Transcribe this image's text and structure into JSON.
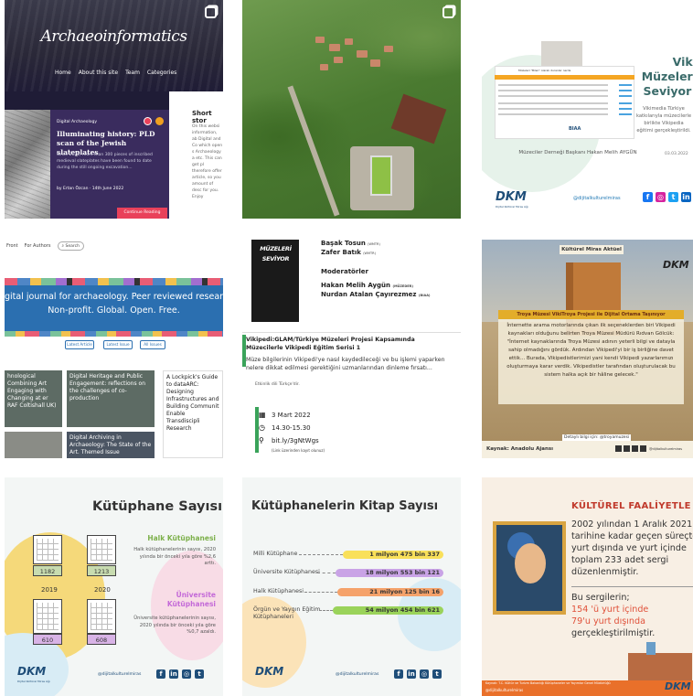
{
  "tile1": {
    "logo": "Archaeoinformatics",
    "nav": [
      "Home",
      "About this site",
      "Team",
      "Categories"
    ],
    "category": "Digital Archaeology",
    "title": "Illuminating history: PLD scan of the Jewish slateplates",
    "excerpt": "Since 2021, more than 300 pieces of inscribed medieval slateplates have been found to date during the still ongoing excavation...",
    "byline": "by Ertan Özcan · 14th June 2022",
    "button": "Continue Reading",
    "side_title": "Short stor",
    "side_text": "On this websi information, ab Digital and Co which open s Archaeology a etc. This can get pl therefore offer article, so you amount of desc for you. Enjoy"
  },
  "tile3": {
    "video_header": "Müzeleri \"Bilen\" olarak duranlar nerde",
    "title": "Viki Müzeleri Seviyor!",
    "subtitle": "Vikimedia Türkiye katkılarıyla müzecilerle birlikte Vikipedia eğitimi gerçekleştirildi.",
    "date": "03.03.2022",
    "presenter": "Müzeciler Derneği Başkanı Hakan Melih AYGÜN",
    "brand": "DKM",
    "brand_sub": "Dijital Kültürel Miras Ağı",
    "handle": "@dijitalkulturelmiras",
    "logo_text": "BIAA"
  },
  "tile4": {
    "nav": [
      "Front",
      "For Authors"
    ],
    "search": "Search",
    "banner_line1": "gital journal for archaeology. Peer reviewed research. Indep",
    "banner_line2": "Non-profit. Global. Open. Free.",
    "buttons": [
      "Latest Article",
      "Latest Issue",
      "All Issues"
    ],
    "cards": [
      "hnological Combining Art Engaging with Changing at er RAF Coltishall UK)",
      "Digital Heritage and Public Engagement: reflections on the challenges of co-production",
      "A Lockpick's Guide to dataARC: Designing Infrastructures and Building Communit Enable Transdiscipli Research",
      "Digital Archiving in Archaeology: The State of the Art. Themed Issue"
    ]
  },
  "tile5": {
    "logo_text": "MÜZELERİ SEVİYOR",
    "speakers": [
      {
        "name": "Başak Tosun",
        "org": "(WMTR)"
      },
      {
        "name": "Zafer Batık",
        "org": "(WMTR)"
      }
    ],
    "moderators_label": "Moderatörler",
    "moderators": [
      {
        "name": "Hakan Melih Aygün",
        "org": "(MÜZEDER)"
      },
      {
        "name": "Nurdan Atalan Çayırezmez",
        "org": "(BIAA)"
      }
    ],
    "heading": "Vikipedi:GLAM/Türkiye Müzeleri Projesi Kapsamında Müzecilerle Vikipedi Eğitim Serisi 1",
    "description": "Müze bilgilerinin Vikipedi'ye nasıl kaydedileceği ve bu işlemi yaparken nelere dikkat edilmesi gerektiğini uzmanlarından dinleme fırsatı...",
    "language": "Etkinlik dili Türkçe'dir.",
    "date": "3 Mart 2022",
    "time": "14.30-15.30",
    "url": "bit.ly/3gNtWgs",
    "link_note": "(Link üzerinden kayıt olunuz)"
  },
  "tile6": {
    "header": "Kültürel Miras Aktüel",
    "brand": "DKM",
    "title": "Troya Müzesi VikiTroya Projesi ile Dijital Ortama Taşınıyor",
    "body": "İnternette arama motorlarında çıkan ilk seçeneklerden biri Vikipedi kaynakları olduğunu belirten Troya Müzesi Müdürü Rıdvan Gölcük: \"İnternet kaynaklarında Troya Müzesi adının yeterli bilgi ve datayla sahip olmadığını gördük. Ardından Vikipedi'yi bir iş birliğine davet ettik... Burada, Vikipedistlerimizi yani kendi Vikipedi yazarlarımızı oluşturmaya karar verdik. Vikipedistler tarafından oluşturulacak bu sistem halka açık bir hâline gelecek.\"",
    "source": "Kaynak: Anadolu Ajansı",
    "details": "Detaylı bilgi için: @troyamuzesi",
    "handle": "@dijitalkulturelmiras"
  },
  "tile7": {
    "title": "Kütüphane Sayısı",
    "values_2019": [
      1182,
      610
    ],
    "values_2020": [
      1213,
      608
    ],
    "years": [
      "2019",
      "2020"
    ],
    "public_heading": "Halk Kütüphanesi",
    "public_text": "Halk kütüphanelerinin sayısı, 2020 yılında bir önceki yıla göre %2,6 arttı.",
    "uni_heading": "Üniversite Kütüphanesi",
    "uni_text": "Üniversite kütüphanelerinin sayısı, 2020 yılında bir önceki yıla göre %0,7 azaldı.",
    "brand": "DKM",
    "brand_sub": "Dijital Kültürel Miras Ağı",
    "handle": "@dijitalkulturelmiras"
  },
  "tile8": {
    "title": "Kütüphanelerin Kitap Sayısı",
    "rows": [
      {
        "label": "Milli Kütüphane",
        "value": "1 milyon 475 bin 337",
        "color": "#f9e05a"
      },
      {
        "label": "Üniversite Kütüphanesi",
        "value": "18 milyon 553 bin 121",
        "color": "#c9a3e6"
      },
      {
        "label": "Halk Kütüphanesi",
        "value": "21 milyon 125 bin 16",
        "color": "#f5a26a"
      },
      {
        "label": "Örgün ve Yaygın Eğitim Kütüphaneleri",
        "value": "54 milyon 454 bin 621",
        "color": "#9ad35a"
      }
    ],
    "brand": "DKM",
    "handle": "@dijitalkulturelmiras"
  },
  "tile9": {
    "title": "KÜLTÜREL FAALİYETLE",
    "text1": "2002 yılından 1 Aralık 2021 tarihine kadar geçen süreçte yurt dışında ve yurt içinde toplam 233 adet sergi düzenlenmiştir.",
    "text2_intro": "Bu sergilerin;",
    "text2_red1": "154 'ü yurt içinde",
    "text2_red2": "79'u yurt dışında",
    "text2_end": "gerçekleştirilmiştir.",
    "footer": "Kaynak: T.C. Kültür ve Turizm Bakanlığı Kütüphaneler ve Yayımlar Genel Müdürlüğü",
    "footer_handle": "@dijitalkulturelmiras",
    "brand": "DKM"
  }
}
